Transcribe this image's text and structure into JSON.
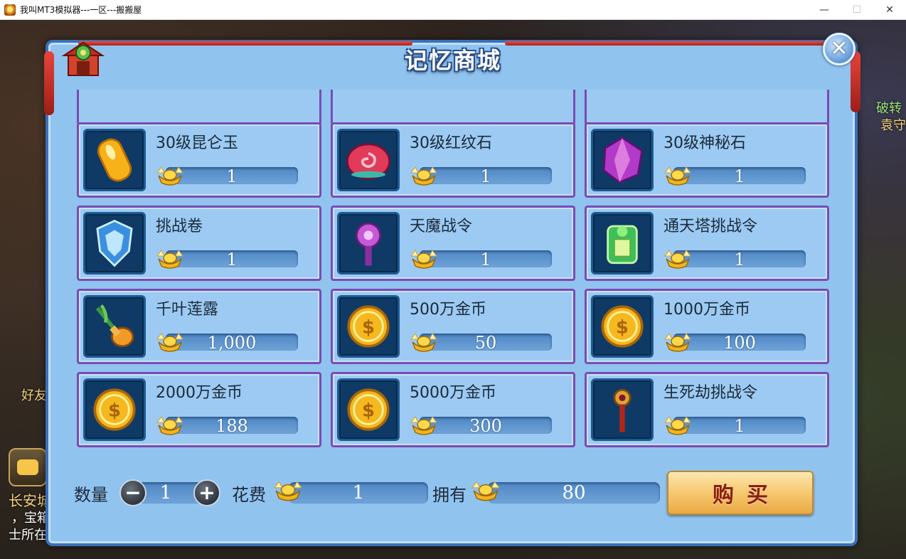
{
  "window": {
    "title": "我叫MT3模拟器---一区---搬搬屋",
    "minimize": "—",
    "maximize": "☐",
    "close": "✕"
  },
  "background": {
    "left_texts": [
      "好友",
      "长安城",
      "，宝箱",
      "士所在"
    ],
    "right_texts": [
      "破转",
      "袁守"
    ]
  },
  "shop": {
    "title": "记忆商城",
    "close_symbol": "✕",
    "items": [
      {
        "name": "30级昆仑玉",
        "price": "1",
        "icon": "kunlun-jade-icon"
      },
      {
        "name": "30级红纹石",
        "price": "1",
        "icon": "red-vein-stone-icon"
      },
      {
        "name": "30级神秘石",
        "price": "1",
        "icon": "mystic-stone-icon"
      },
      {
        "name": "挑战卷",
        "price": "1",
        "icon": "challenge-scroll-icon"
      },
      {
        "name": "天魔战令",
        "price": "1",
        "icon": "demon-war-token-icon"
      },
      {
        "name": "通天塔挑战令",
        "price": "1",
        "icon": "tower-challenge-token-icon"
      },
      {
        "name": "千叶莲露",
        "price": "1,000",
        "icon": "lotus-dew-icon"
      },
      {
        "name": "500万金币",
        "price": "50",
        "icon": "gold-coin-icon"
      },
      {
        "name": "1000万金币",
        "price": "100",
        "icon": "gold-coin-icon"
      },
      {
        "name": "2000万金币",
        "price": "188",
        "icon": "gold-coin-icon"
      },
      {
        "name": "5000万金币",
        "price": "300",
        "icon": "gold-coin-icon"
      },
      {
        "name": "生死劫挑战令",
        "price": "1",
        "icon": "life-death-token-icon"
      }
    ]
  },
  "footer": {
    "quantity_label": "数量",
    "quantity": "1",
    "minus": "−",
    "plus": "+",
    "cost_label": "花费",
    "cost": "1",
    "owned_label": "拥有",
    "owned": "80",
    "buy_label": "购买"
  },
  "colors": {
    "panel": "#91c3ef",
    "card_border": "#7a4bb4",
    "icon_frame": "#0f3a66",
    "buy_button": "#f5c56a"
  }
}
